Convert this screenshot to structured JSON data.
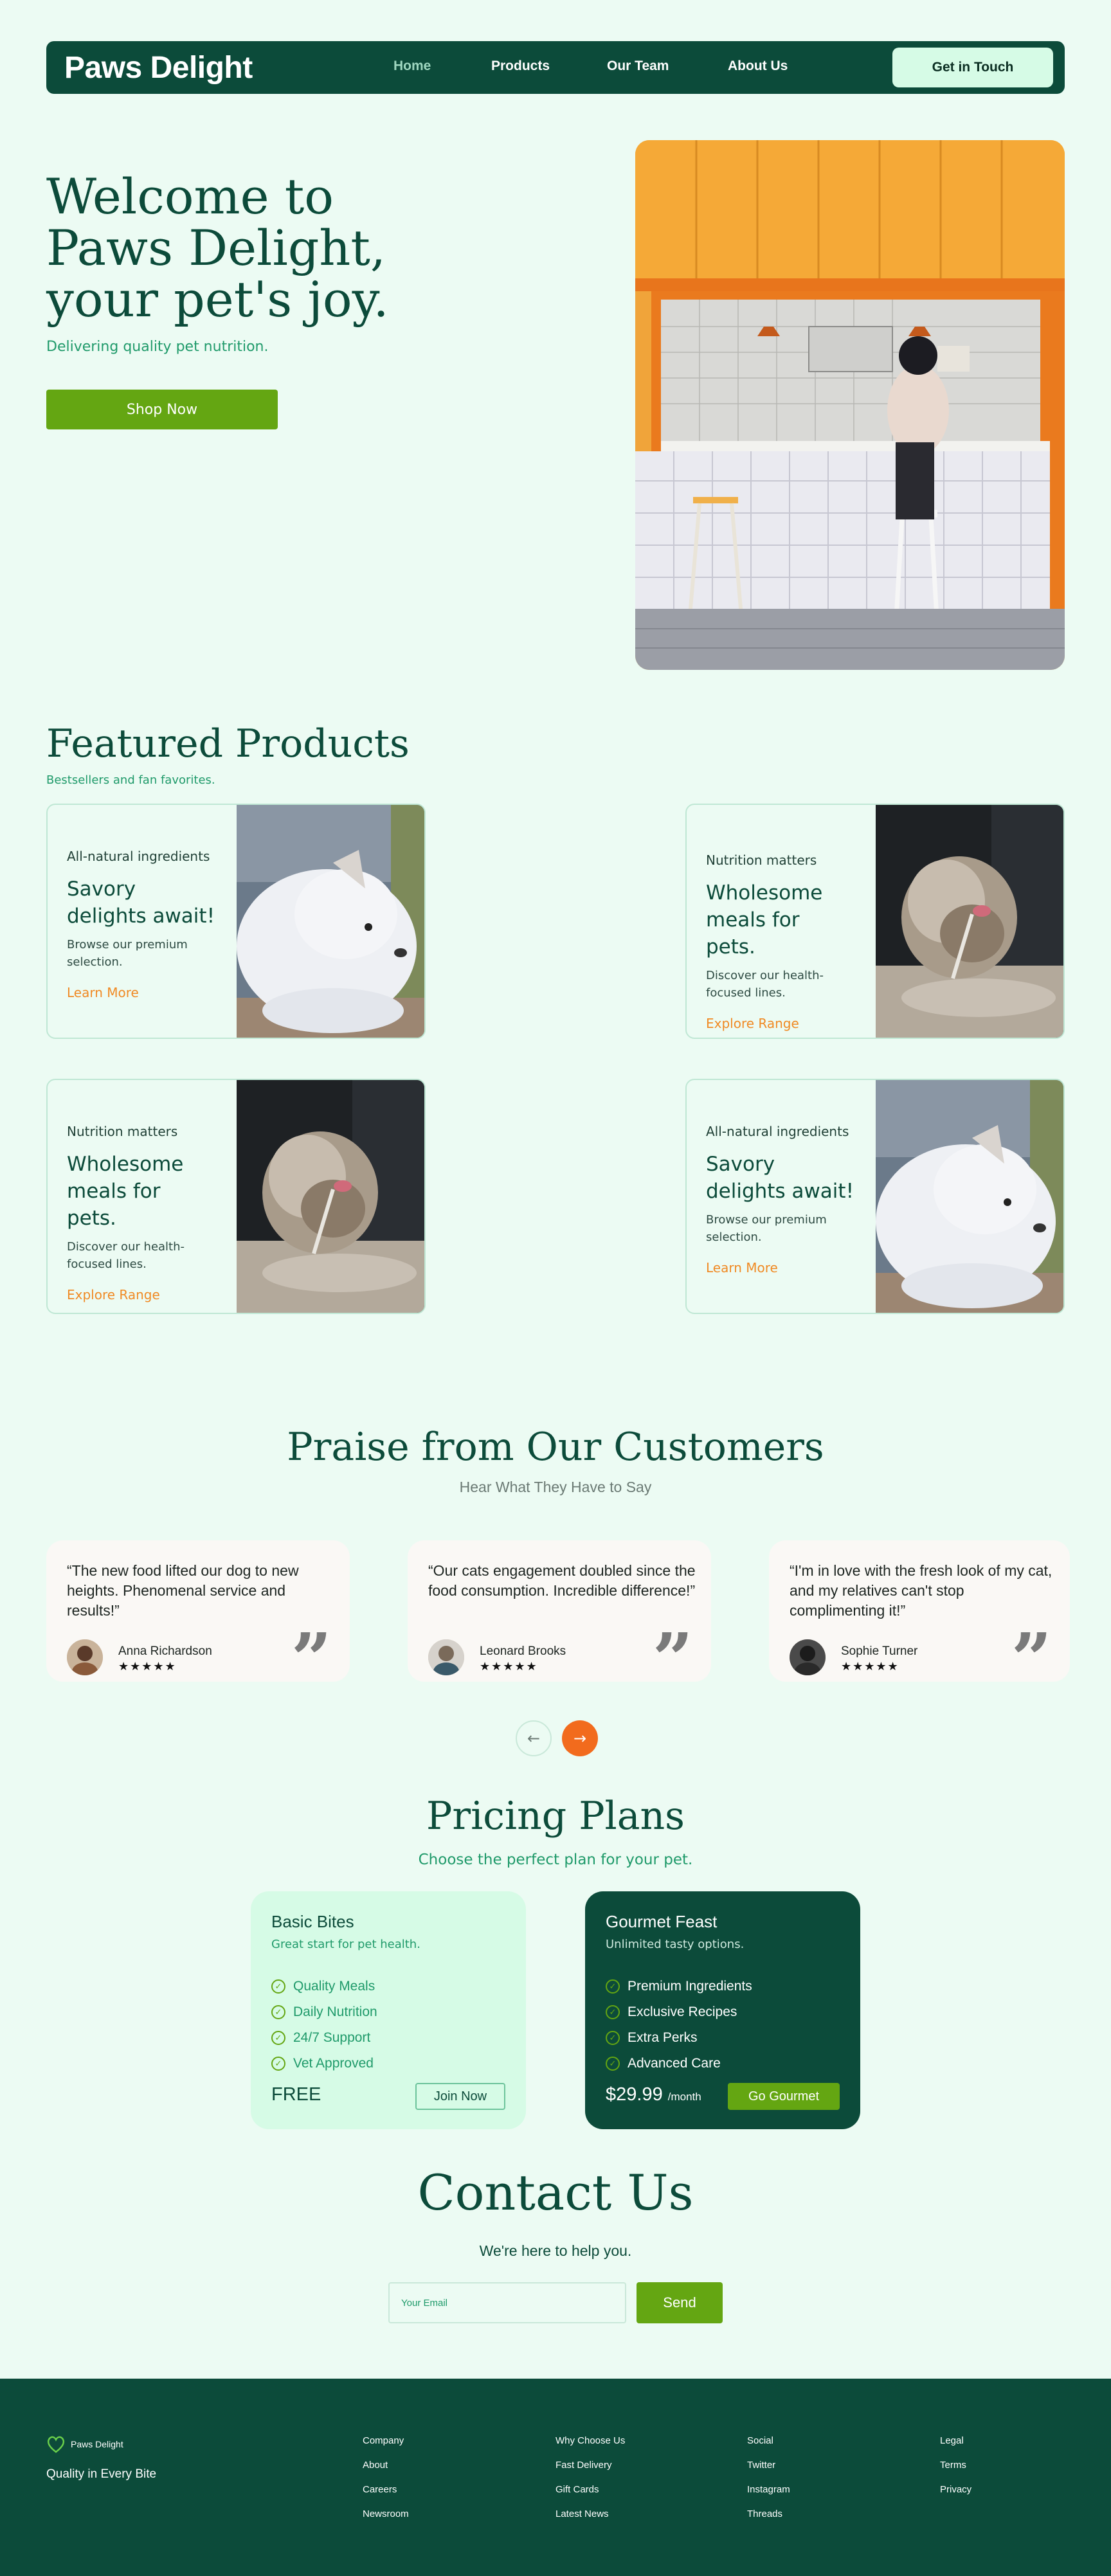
{
  "nav": {
    "brand": "Paws Delight",
    "links": [
      "Home",
      "Products",
      "Our Team",
      "About Us"
    ],
    "cta": "Get in Touch"
  },
  "hero": {
    "title": "Welcome to Paws Delight, your pet's joy.",
    "subtitle": "Delivering quality pet nutrition.",
    "button": "Shop Now"
  },
  "featured": {
    "title": "Featured Products",
    "subtitle": "Bestsellers and fan favorites.",
    "cards": [
      {
        "kicker": "All-natural ingredients",
        "title": "Savory delights await!",
        "desc": "Browse our premium selection.",
        "link": "Learn More",
        "image": "white-dog"
      },
      {
        "kicker": "Nutrition matters",
        "title": "Wholesome meals for pets.",
        "desc": "Discover our health-focused lines.",
        "link": "Explore Range",
        "image": "fluffy-dog"
      },
      {
        "kicker": "Nutrition matters",
        "title": "Wholesome meals for pets.",
        "desc": "Discover our health-focused lines.",
        "link": "Explore Range",
        "image": "fluffy-dog"
      },
      {
        "kicker": "All-natural ingredients",
        "title": "Savory delights await!",
        "desc": "Browse our premium selection.",
        "link": "Learn More",
        "image": "white-dog"
      }
    ]
  },
  "praise": {
    "title": "Praise from Our Customers",
    "subtitle": "Hear What They Have to Say",
    "testimonials": [
      {
        "quote": "“The new food lifted our dog to new heights. Phenomenal service and results!”",
        "name": "Anna Richardson",
        "stars": "★★★★★"
      },
      {
        "quote": "“Our cats engagement doubled since the food consumption. Incredible difference!”",
        "name": "Leonard Brooks",
        "stars": "★★★★★"
      },
      {
        "quote": "“I'm in love with the fresh look of my cat, and my relatives can't stop complimenting it!”",
        "name": "Sophie Turner",
        "stars": "★★★★★"
      }
    ],
    "prev_icon": "←",
    "next_icon": "→"
  },
  "pricing": {
    "title": "Pricing Plans",
    "subtitle": "Choose the perfect plan for your pet.",
    "basic": {
      "name": "Basic Bites",
      "tagline": "Great start for pet health.",
      "features": [
        "Quality Meals",
        "Daily Nutrition",
        "24/7 Support",
        "Vet Approved"
      ],
      "price": "FREE",
      "button": "Join Now"
    },
    "gourmet": {
      "name": "Gourmet Feast",
      "tagline": "Unlimited tasty options.",
      "features": [
        "Premium Ingredients",
        "Exclusive Recipes",
        "Extra Perks",
        "Advanced Care"
      ],
      "price": "$29.99",
      "period": "/month",
      "button": "Go Gourmet"
    }
  },
  "contact": {
    "title": "Contact Us",
    "subtitle": "We're here to help you.",
    "placeholder": "Your Email",
    "button": "Send"
  },
  "footer": {
    "brand": "Paws Delight",
    "tagline": "Quality in Every Bite",
    "columns": [
      [
        "Company",
        "About",
        "Careers",
        "Newsroom"
      ],
      [
        "Why Choose Us",
        "Fast Delivery",
        "Gift Cards",
        "Latest News"
      ],
      [
        "Social",
        "Twitter",
        "Instagram",
        "Threads"
      ],
      [
        "Legal",
        "Terms",
        "Privacy"
      ]
    ]
  },
  "colors": {
    "background": "#ecfbf3",
    "dark_green": "#0c4b3a",
    "accent_green": "#64a612",
    "orange": "#f08a24",
    "mint": "#d6fbe6"
  }
}
